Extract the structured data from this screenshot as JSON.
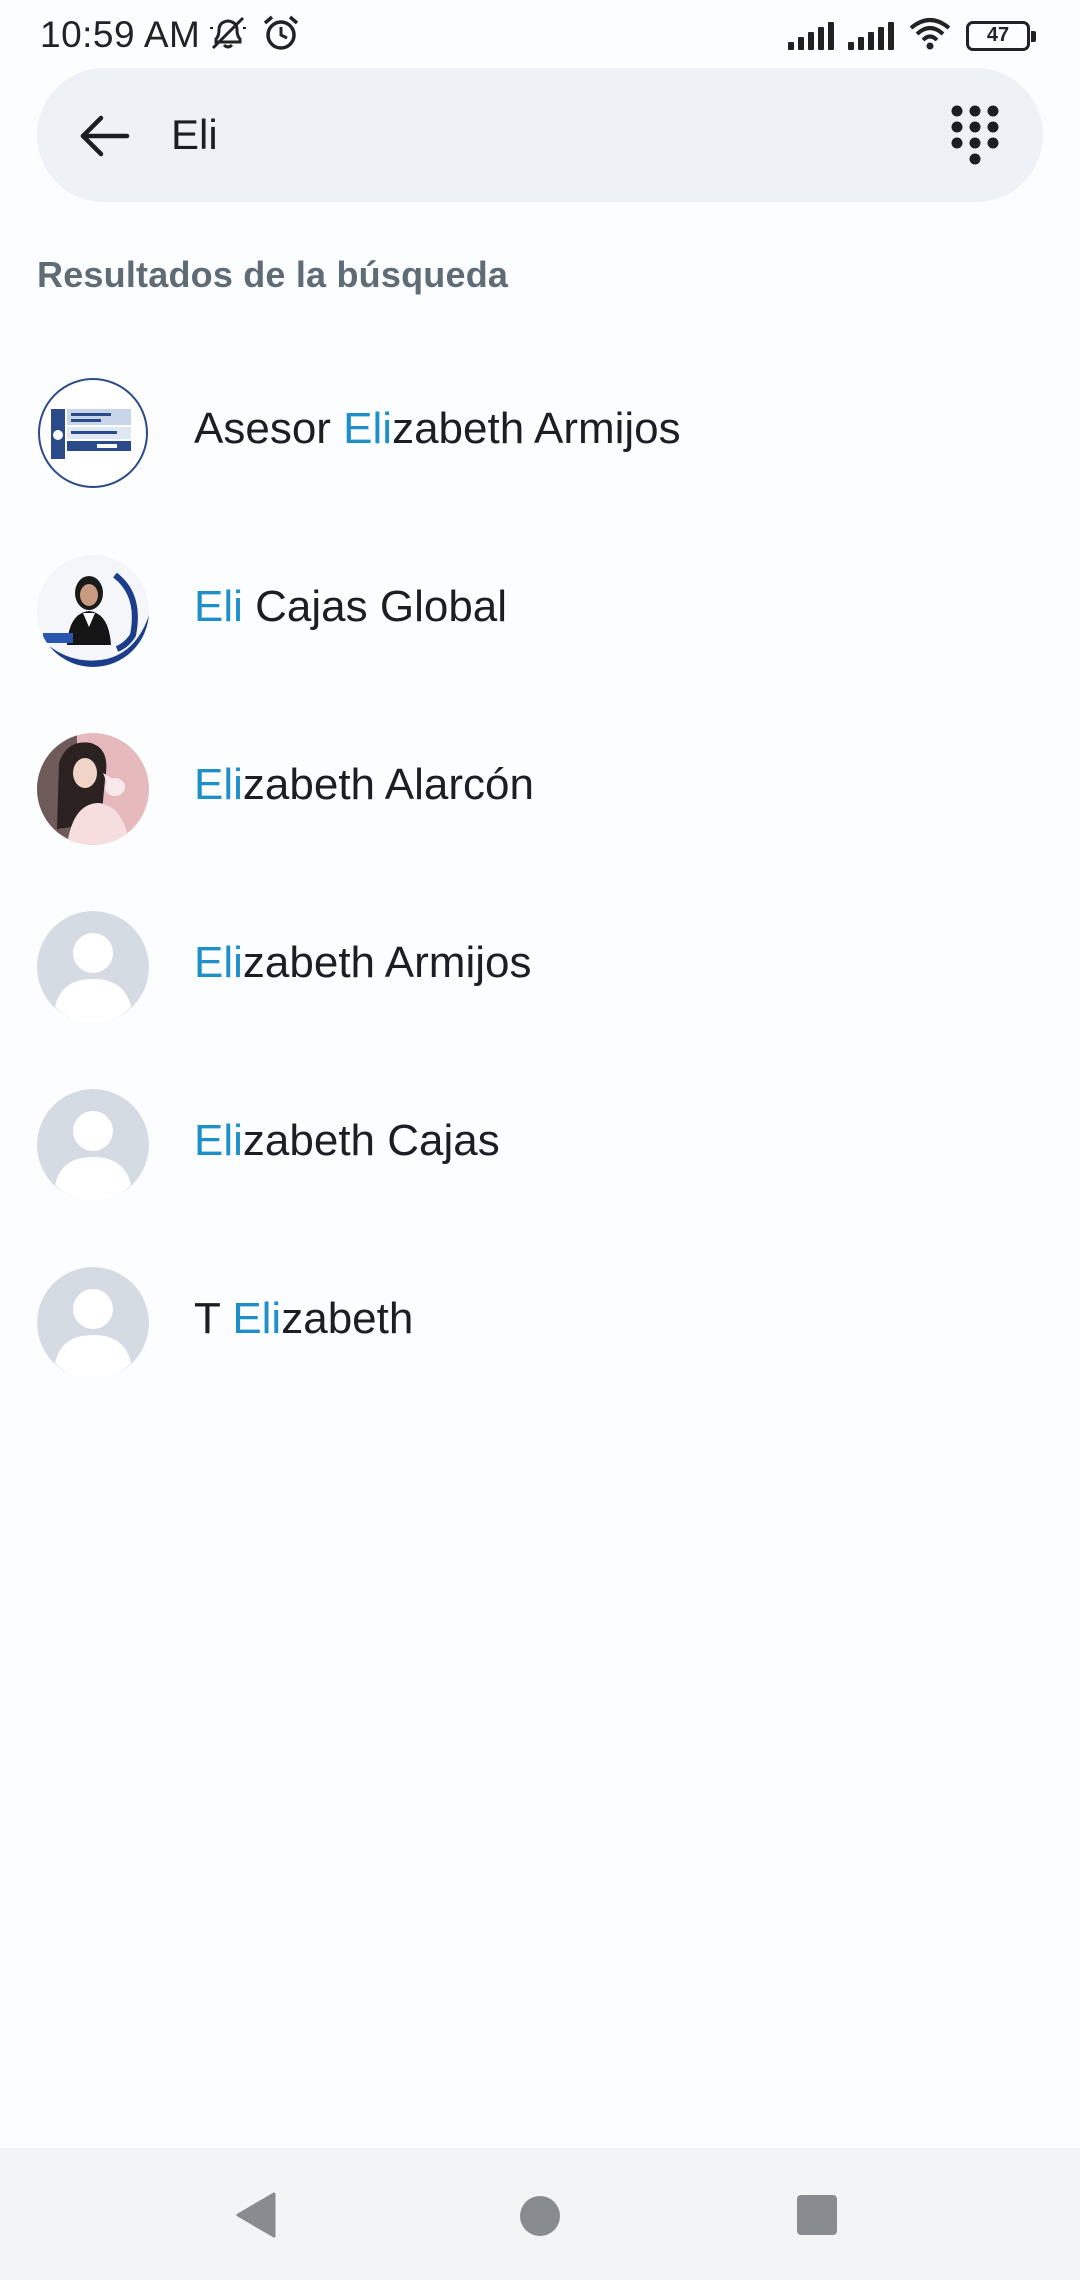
{
  "status_bar": {
    "time": "10:59 AM",
    "battery": "47",
    "icons": [
      "notifications-off-icon",
      "alarm-icon",
      "signal-icon",
      "signal-icon",
      "wifi-icon",
      "battery-icon"
    ]
  },
  "search": {
    "value": "Eli",
    "back_icon": "arrow-left-icon",
    "dialpad_icon": "dialpad-icon"
  },
  "results_header": "Resultados de la búsqueda",
  "highlight_color": "#1e8fc8",
  "results": [
    {
      "prefix": "Asesor ",
      "match": "Eli",
      "suffix": "zabeth Armijos",
      "avatar": "global-english-logo"
    },
    {
      "prefix": "",
      "match": "Eli",
      "suffix": " Cajas Global",
      "avatar": "photo-woman-blue"
    },
    {
      "prefix": "",
      "match": "Eli",
      "suffix": "zabeth Alarcón",
      "avatar": "photo-woman-pink"
    },
    {
      "prefix": "",
      "match": "Eli",
      "suffix": "zabeth Armijos",
      "avatar": "default-person"
    },
    {
      "prefix": "",
      "match": "Eli",
      "suffix": "zabeth Cajas",
      "avatar": "default-person"
    },
    {
      "prefix": "T ",
      "match": "Eli",
      "suffix": "zabeth",
      "avatar": "default-person"
    }
  ],
  "nav": {
    "back_icon": "triangle-back-icon",
    "home_icon": "circle-home-icon",
    "recents_icon": "square-recents-icon"
  }
}
